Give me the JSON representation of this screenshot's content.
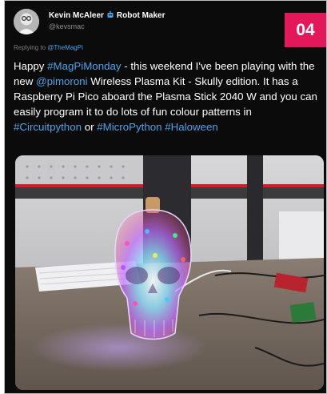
{
  "page_number": "04",
  "author": {
    "display_name": "Kevin McAleer",
    "title_after_badge": "Robot Maker",
    "handle": "@kevsmac"
  },
  "reply": {
    "prefix": "Replying to",
    "mention": "@TheMagPi"
  },
  "tweet": {
    "t1": "Happy ",
    "tag1": "#MagPiMonday",
    "t2": " - this weekend I've been playing with the new ",
    "tag2": "@pimoroni",
    "t3": " Wireless Plasma Kit - Skully edition. It has a Raspberry Pi Pico aboard the Plasma Stick 2040 W and you can easily program it to do lots of fun colour patterns in ",
    "tag3": "#Circuitpython",
    "t4": " or ",
    "tag4": "#MicroPython",
    "t5": " ",
    "tag5": "#Haloween"
  },
  "colors": {
    "accent_tab": "#e3185a",
    "link": "#4aa3e8",
    "background": "#0b0b0b"
  },
  "icons": {
    "badge": "robot-badge-icon"
  }
}
